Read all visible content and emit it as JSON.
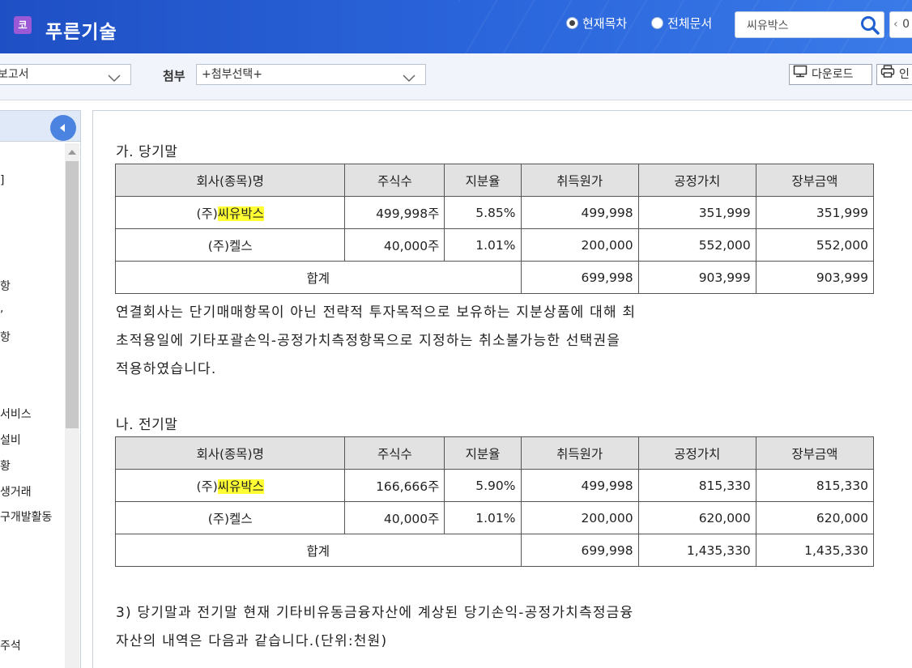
{
  "header": {
    "logo_icon_char": "코",
    "app_title": "푸른기술",
    "radio_current": "현재목차",
    "radio_all": "전체문서",
    "search_value": "씨유박스",
    "nav_value": "0"
  },
  "toolbar": {
    "report_select": "보고서",
    "attach_label": "첨부",
    "attach_select": "+첨부선택+",
    "download_label": "다운로드",
    "print_label": "인"
  },
  "sidebar": {
    "items": [
      {
        "label": "]"
      },
      {
        "label": "항"
      },
      {
        "label": ","
      },
      {
        "label": "항"
      },
      {
        "label": "서비스"
      },
      {
        "label": "설비"
      },
      {
        "label": "황"
      },
      {
        "label": "생거래"
      },
      {
        "label": "구개발활동"
      },
      {
        "label": "주석"
      }
    ]
  },
  "document": {
    "section_a_title": "가. 당기말",
    "section_b_title": "나. 전기말",
    "columns": [
      "회사(종목)명",
      "주식수",
      "지분율",
      "취득원가",
      "공정가치",
      "장부금액"
    ],
    "table_current": {
      "rows": [
        {
          "name_prefix": "(주)",
          "name_highlight": "씨유박스",
          "shares": "499,998주",
          "ratio": "5.85%",
          "cost": "499,998",
          "fair": "351,999",
          "book": "351,999"
        },
        {
          "name_prefix": "(주)켈스",
          "name_highlight": "",
          "shares": "40,000주",
          "ratio": "1.01%",
          "cost": "200,000",
          "fair": "552,000",
          "book": "552,000"
        }
      ],
      "total": {
        "label": "합계",
        "cost": "699,998",
        "fair": "903,999",
        "book": "903,999"
      }
    },
    "table_prior": {
      "rows": [
        {
          "name_prefix": "(주)",
          "name_highlight": "씨유박스",
          "shares": "166,666주",
          "ratio": "5.90%",
          "cost": "499,998",
          "fair": "815,330",
          "book": "815,330"
        },
        {
          "name_prefix": "(주)켈스",
          "name_highlight": "",
          "shares": "40,000주",
          "ratio": "1.01%",
          "cost": "200,000",
          "fair": "620,000",
          "book": "620,000"
        }
      ],
      "total": {
        "label": "합계",
        "cost": "699,998",
        "fair": "1,435,330",
        "book": "1,435,330"
      }
    },
    "paragraph1": [
      "연결회사는 단기매매항목이 아닌 전략적 투자목적으로 보유하는 지분상품에 대해 최",
      "초적용일에 기타포괄손익-공정가치측정항목으로 지정하는 취소불가능한 선택권을",
      "적용하였습니다."
    ],
    "paragraph2": [
      "3) 당기말과 전기말 현재 기타비유동금융자산에 계상된 당기손익-공정가치측정금융",
      "자산의 내역은 다음과 같습니다.(단위:천원)"
    ]
  },
  "colors": {
    "header_blue": "#2b66dc",
    "logo_purple": "#9b59d6",
    "highlight_yellow": "#ffff33",
    "table_header_gray": "#e2e2e2"
  }
}
